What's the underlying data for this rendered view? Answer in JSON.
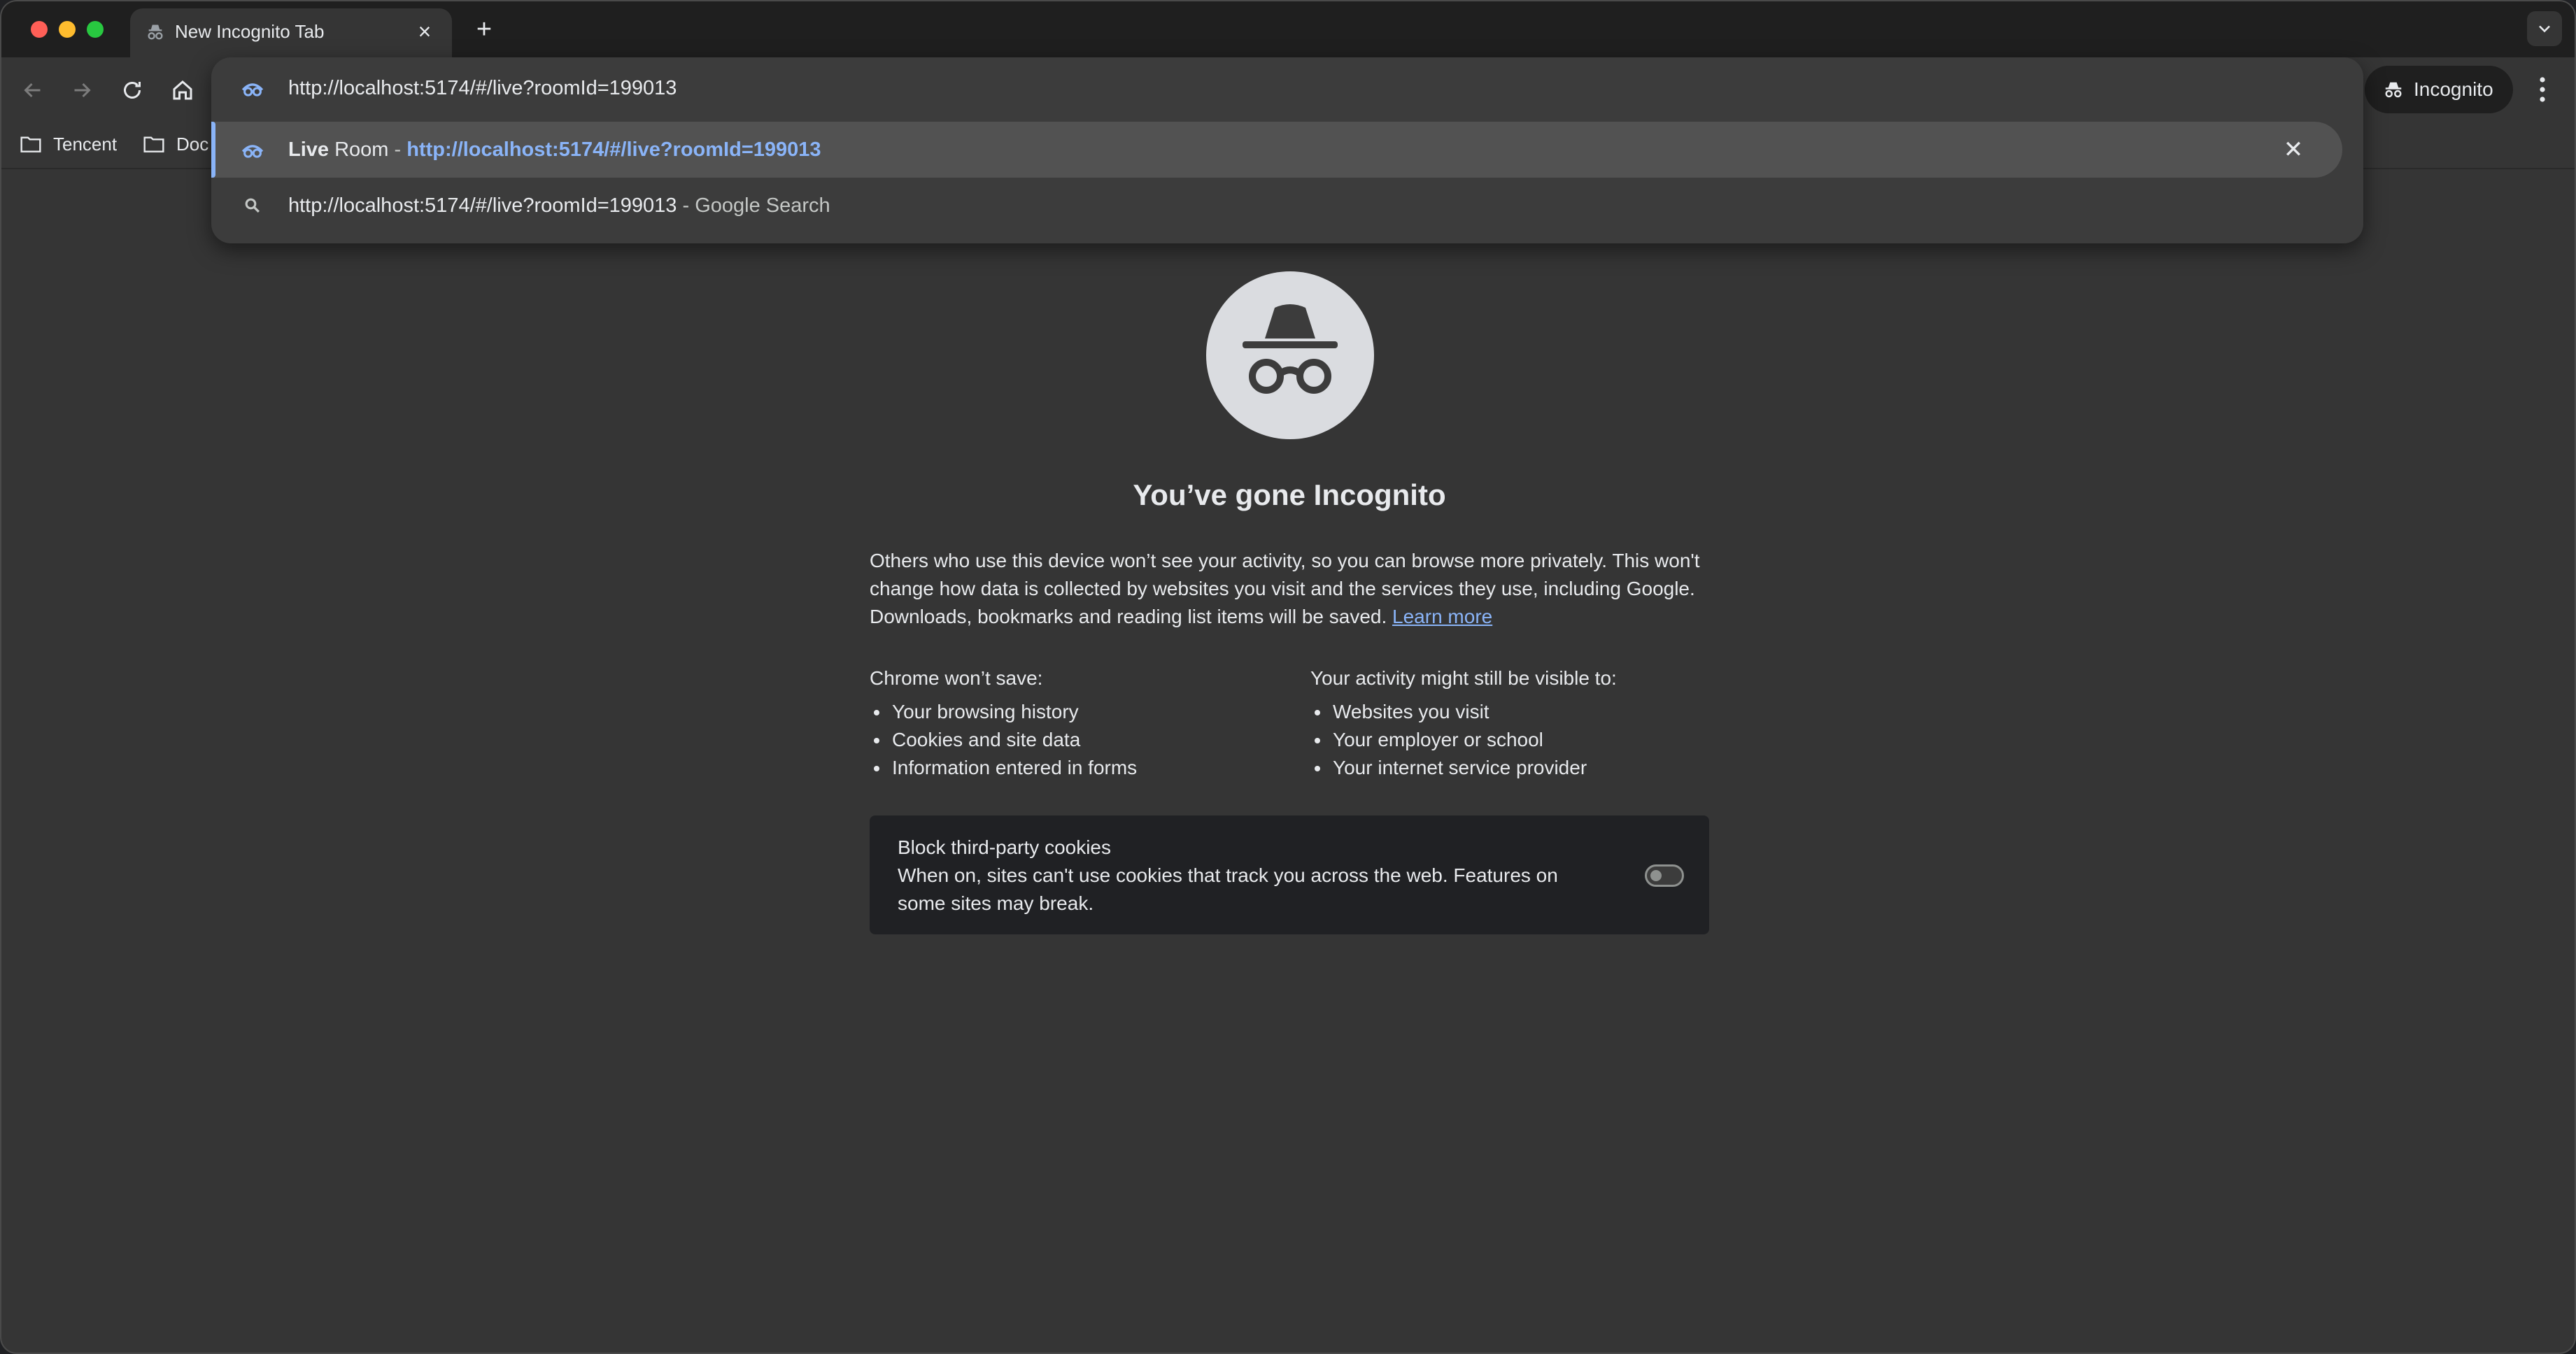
{
  "tab": {
    "title": "New Incognito Tab",
    "close": "×",
    "new_tab": "+"
  },
  "toolbar": {
    "profile_label": "Incognito"
  },
  "bookmarks": [
    {
      "label": "Tencent"
    },
    {
      "label": "Doc"
    }
  ],
  "omnibox": {
    "value": "http://localhost:5174/#/live?roomId=199013",
    "suggestions": [
      {
        "title_bold": "Live",
        "title_rest": " Room",
        "separator": " - ",
        "url": "http://localhost:5174/#/live?roomId=199013",
        "close": "✕"
      },
      {
        "query": "http://localhost:5174/#/live?roomId=199013",
        "suffix": " - Google Search"
      }
    ]
  },
  "content": {
    "heading": "You’ve gone Incognito",
    "intro": "Others who use this device won’t see your activity, so you can browse more privately. This won't change how data is collected by websites you visit and the services they use, including Google. Downloads, bookmarks and reading list items will be saved. ",
    "learn_more": "Learn more",
    "left_title": "Chrome won’t save:",
    "left_items": [
      "Your browsing history",
      "Cookies and site data",
      "Information entered in forms"
    ],
    "right_title": "Your activity might still be visible to:",
    "right_items": [
      "Websites you visit",
      "Your employer or school",
      "Your internet service provider"
    ],
    "cookie_title": "Block third-party cookies",
    "cookie_desc": "When on, sites can't use cookies that track you across the web. Features on some sites may break.",
    "cookie_toggle_on": false
  },
  "colors": {
    "accent": "#8ab4f8",
    "background": "#353535",
    "panel": "#202124"
  }
}
